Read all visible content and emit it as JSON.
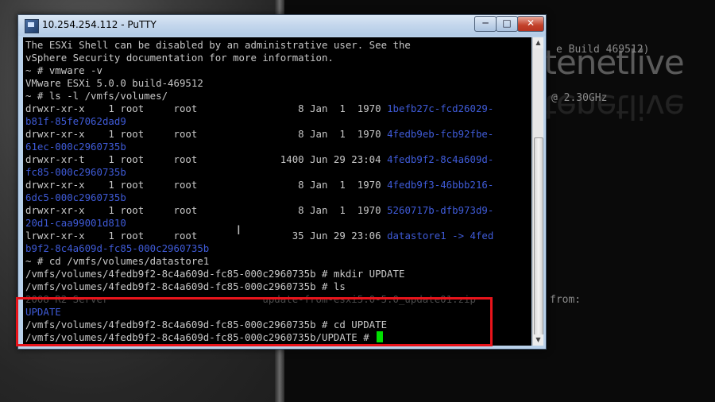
{
  "window": {
    "title": "10.254.254.112 - PuTTY",
    "min_label": "─",
    "max_label": "□",
    "close_label": "✕"
  },
  "terminal_lines": [
    {
      "parts": [
        {
          "text": "The ESXi Shell can be disabled by an administrative user. See the",
          "color": "default"
        }
      ]
    },
    {
      "parts": [
        {
          "text": "vSphere Security documentation for more information.",
          "color": "default"
        }
      ]
    },
    {
      "parts": [
        {
          "text": "~ # vmware -v",
          "color": "default"
        }
      ]
    },
    {
      "parts": [
        {
          "text": "VMware ESXi 5.0.0 build-469512",
          "color": "default"
        }
      ]
    },
    {
      "parts": [
        {
          "text": "~ # ls -l /vmfs/volumes/",
          "color": "default"
        }
      ]
    },
    {
      "parts": [
        {
          "text": "drwxr-xr-x    1 root     root                 8 Jan  1  1970 ",
          "color": "default"
        },
        {
          "text": "1befb27c-fcd26029-",
          "color": "blue"
        }
      ]
    },
    {
      "parts": [
        {
          "text": "b81f-85fe7062dad9",
          "color": "blue"
        }
      ]
    },
    {
      "parts": [
        {
          "text": "drwxr-xr-x    1 root     root                 8 Jan  1  1970 ",
          "color": "default"
        },
        {
          "text": "4fedb9eb-fcb92fbe-",
          "color": "blue"
        }
      ]
    },
    {
      "parts": [
        {
          "text": "61ec-000c2960735b",
          "color": "blue"
        }
      ]
    },
    {
      "parts": [
        {
          "text": "drwxr-xr-t    1 root     root              1400 Jun 29 23:04 ",
          "color": "default"
        },
        {
          "text": "4fedb9f2-8c4a609d-",
          "color": "blue"
        }
      ]
    },
    {
      "parts": [
        {
          "text": "fc85-000c2960735b",
          "color": "blue"
        }
      ]
    },
    {
      "parts": [
        {
          "text": "drwxr-xr-x    1 root     root                 8 Jan  1  1970 ",
          "color": "default"
        },
        {
          "text": "4fedb9f3-46bbb216-",
          "color": "blue"
        }
      ]
    },
    {
      "parts": [
        {
          "text": "6dc5-000c2960735b",
          "color": "blue"
        }
      ]
    },
    {
      "parts": [
        {
          "text": "drwxr-xr-x    1 root     root                 8 Jan  1  1970 ",
          "color": "default"
        },
        {
          "text": "5260717b-dfb973d9-",
          "color": "blue"
        }
      ]
    },
    {
      "parts": [
        {
          "text": "20d1-caa99001d810",
          "color": "blue"
        }
      ]
    },
    {
      "parts": [
        {
          "text": "lrwxr-xr-x    1 root     root                35 Jun 29 23:06 ",
          "color": "default"
        },
        {
          "text": "datastore1 -> 4fed",
          "color": "blue"
        }
      ]
    },
    {
      "parts": [
        {
          "text": "b9f2-8c4a609d-fc85-000c2960735b",
          "color": "blue"
        }
      ]
    },
    {
      "parts": [
        {
          "text": "~ # cd /vmfs/volumes/datastore1",
          "color": "default"
        }
      ]
    },
    {
      "parts": [
        {
          "text": "/vmfs/volumes/4fedb9f2-8c4a609d-fc85-000c2960735b # mkdir UPDATE",
          "color": "default"
        }
      ]
    },
    {
      "parts": [
        {
          "text": "/vmfs/volumes/4fedb9f2-8c4a609d-fc85-000c2960735b # ls",
          "color": "default"
        }
      ]
    },
    {
      "parts": [
        {
          "text": "2008 R2 Server                          update-from-esxi5.0-5.0_update01.zip",
          "color": "dim"
        }
      ]
    },
    {
      "parts": [
        {
          "text": "UPDATE",
          "color": "blue"
        }
      ]
    },
    {
      "parts": [
        {
          "text": "/vmfs/volumes/4fedb9f2-8c4a609d-fc85-000c2960735b # cd UPDATE",
          "color": "default"
        }
      ]
    },
    {
      "parts": [
        {
          "text": "/vmfs/volumes/4fedb9f2-8c4a609d-fc85-000c2960735b/UPDATE # ",
          "color": "default"
        }
      ],
      "cursor": true
    }
  ],
  "background": {
    "console_build": "e Build 469512)",
    "console_cpu": "@ 2.30GHz",
    "console_from": "from:",
    "logo_text": "petenetlive"
  },
  "colors": {
    "terminal_bg": "#000000",
    "terminal_fg": "#c8c8c8",
    "dir_blue": "#3f5bd8",
    "cursor": "#00e000",
    "highlight_box": "#e8141b"
  }
}
